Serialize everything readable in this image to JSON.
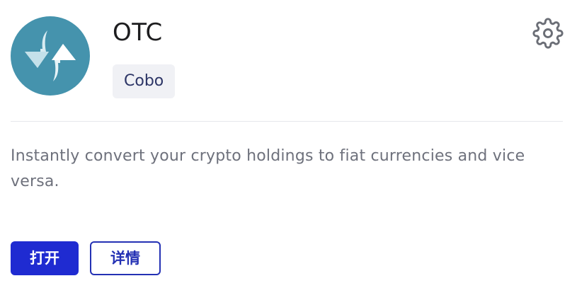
{
  "app": {
    "title": "OTC",
    "provider": "Cobo",
    "description": "Instantly convert your crypto holdings to fiat currencies and vice versa.",
    "icon": "swap-arrows-icon",
    "logo_color": "#4593ad"
  },
  "toolbar": {
    "settings_icon": "gear-icon"
  },
  "actions": {
    "open_label": "打开",
    "details_label": "详情"
  },
  "colors": {
    "primary": "#1f2bd1",
    "text": "#1d1d1f",
    "muted_text": "#6e717c",
    "badge_bg": "#f0f1f5"
  }
}
